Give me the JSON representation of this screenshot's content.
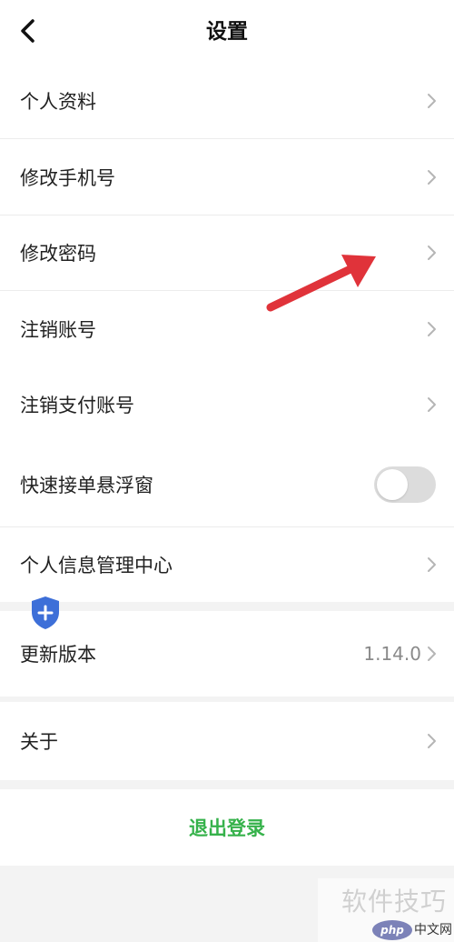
{
  "header": {
    "title": "设置",
    "back_icon": "chevron-left-icon"
  },
  "menu": {
    "profile": "个人资料",
    "change_phone": "修改手机号",
    "change_password": "修改密码",
    "cancel_account": "注销账号",
    "cancel_payment_account": "注销支付账号",
    "quick_order_float": "快速接单悬浮窗",
    "personal_info_center": "个人信息管理中心",
    "update_version": "更新版本",
    "update_version_value": "1.14.0",
    "about": "关于"
  },
  "toggle": {
    "quick_order_float_on": false
  },
  "logout": {
    "label": "退出登录"
  },
  "watermark": {
    "text": "软件技巧",
    "logo_text": "php",
    "site_text": "中文网"
  },
  "colors": {
    "accent_green": "#36b24b",
    "arrow_red": "#e0333a",
    "shield_blue": "#3d6fd8"
  }
}
